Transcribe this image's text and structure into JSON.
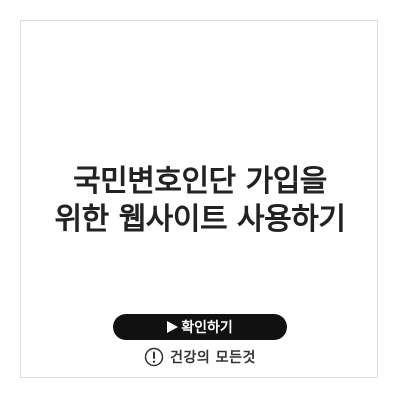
{
  "title": {
    "line1": "국민변호인단 가입을",
    "line2": "위한 웹사이트 사용하기"
  },
  "cta": {
    "label": "확인하기",
    "icon": "play-icon"
  },
  "brand": {
    "name": "건강의 모든것",
    "icon": "exclamation-circle-icon"
  }
}
